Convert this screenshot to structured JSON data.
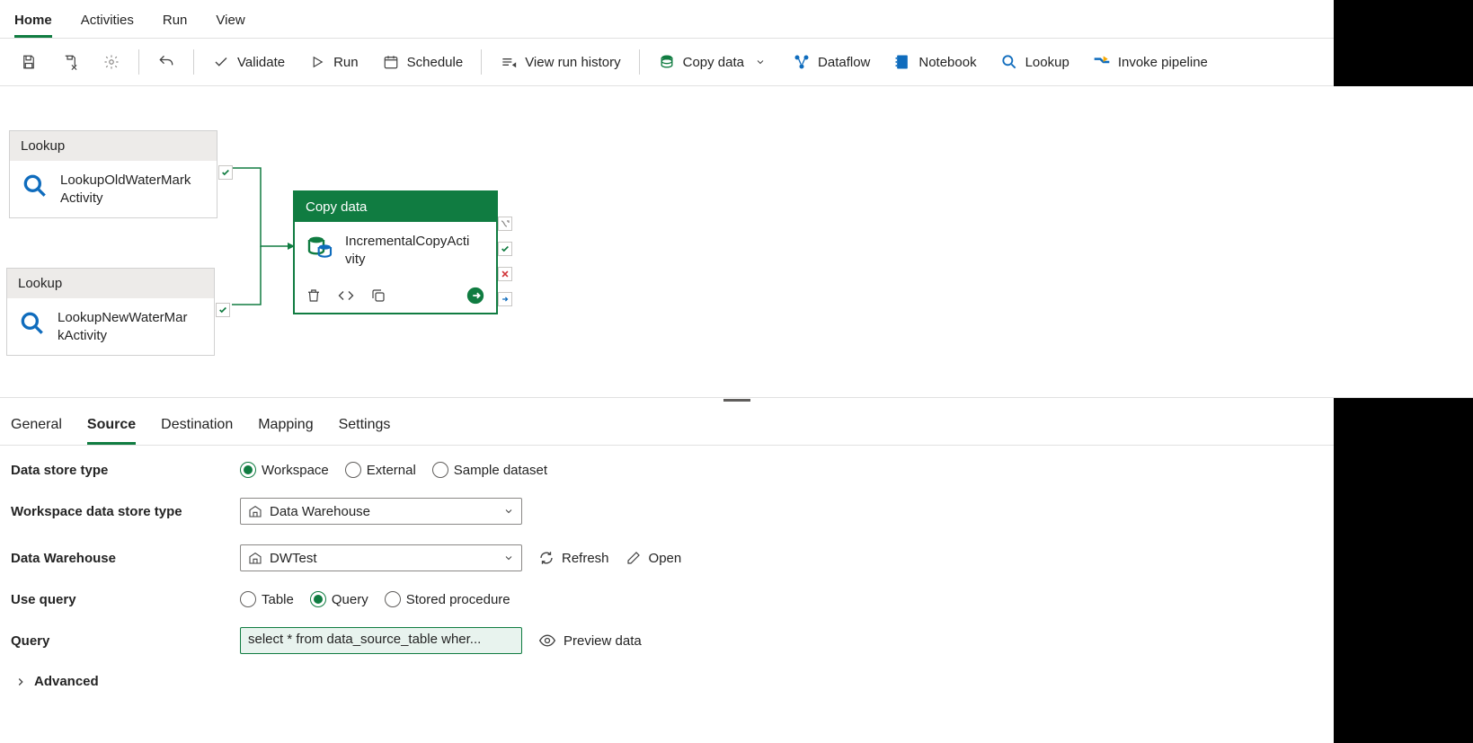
{
  "menu": {
    "tabs": [
      "Home",
      "Activities",
      "Run",
      "View"
    ],
    "active": 0
  },
  "toolbar": {
    "validate": "Validate",
    "run": "Run",
    "schedule": "Schedule",
    "view_run_history": "View run history",
    "copy_data": "Copy data",
    "dataflow": "Dataflow",
    "notebook": "Notebook",
    "lookup": "Lookup",
    "invoke_pipeline": "Invoke pipeline"
  },
  "canvas": {
    "nodes": [
      {
        "type": "Lookup",
        "name": "LookupOldWaterMarkActivity"
      },
      {
        "type": "Lookup",
        "name": "LookupNewWaterMarkActivity"
      },
      {
        "type": "Copy data",
        "name": "IncrementalCopyActivity"
      }
    ]
  },
  "panel": {
    "tabs": [
      "General",
      "Source",
      "Destination",
      "Mapping",
      "Settings"
    ],
    "active": 1,
    "labels": {
      "data_store_type": "Data store type",
      "workspace_data_store_type": "Workspace data store type",
      "data_warehouse": "Data Warehouse",
      "use_query": "Use query",
      "query": "Query",
      "advanced": "Advanced"
    },
    "radios": {
      "workspace": "Workspace",
      "external": "External",
      "sample_dataset": "Sample dataset",
      "table": "Table",
      "query": "Query",
      "stored_procedure": "Stored procedure"
    },
    "selects": {
      "ws_type": "Data Warehouse",
      "dw": "DWTest"
    },
    "actions": {
      "refresh": "Refresh",
      "open": "Open",
      "preview": "Preview data"
    },
    "query_text": "select * from data_source_table wher..."
  }
}
